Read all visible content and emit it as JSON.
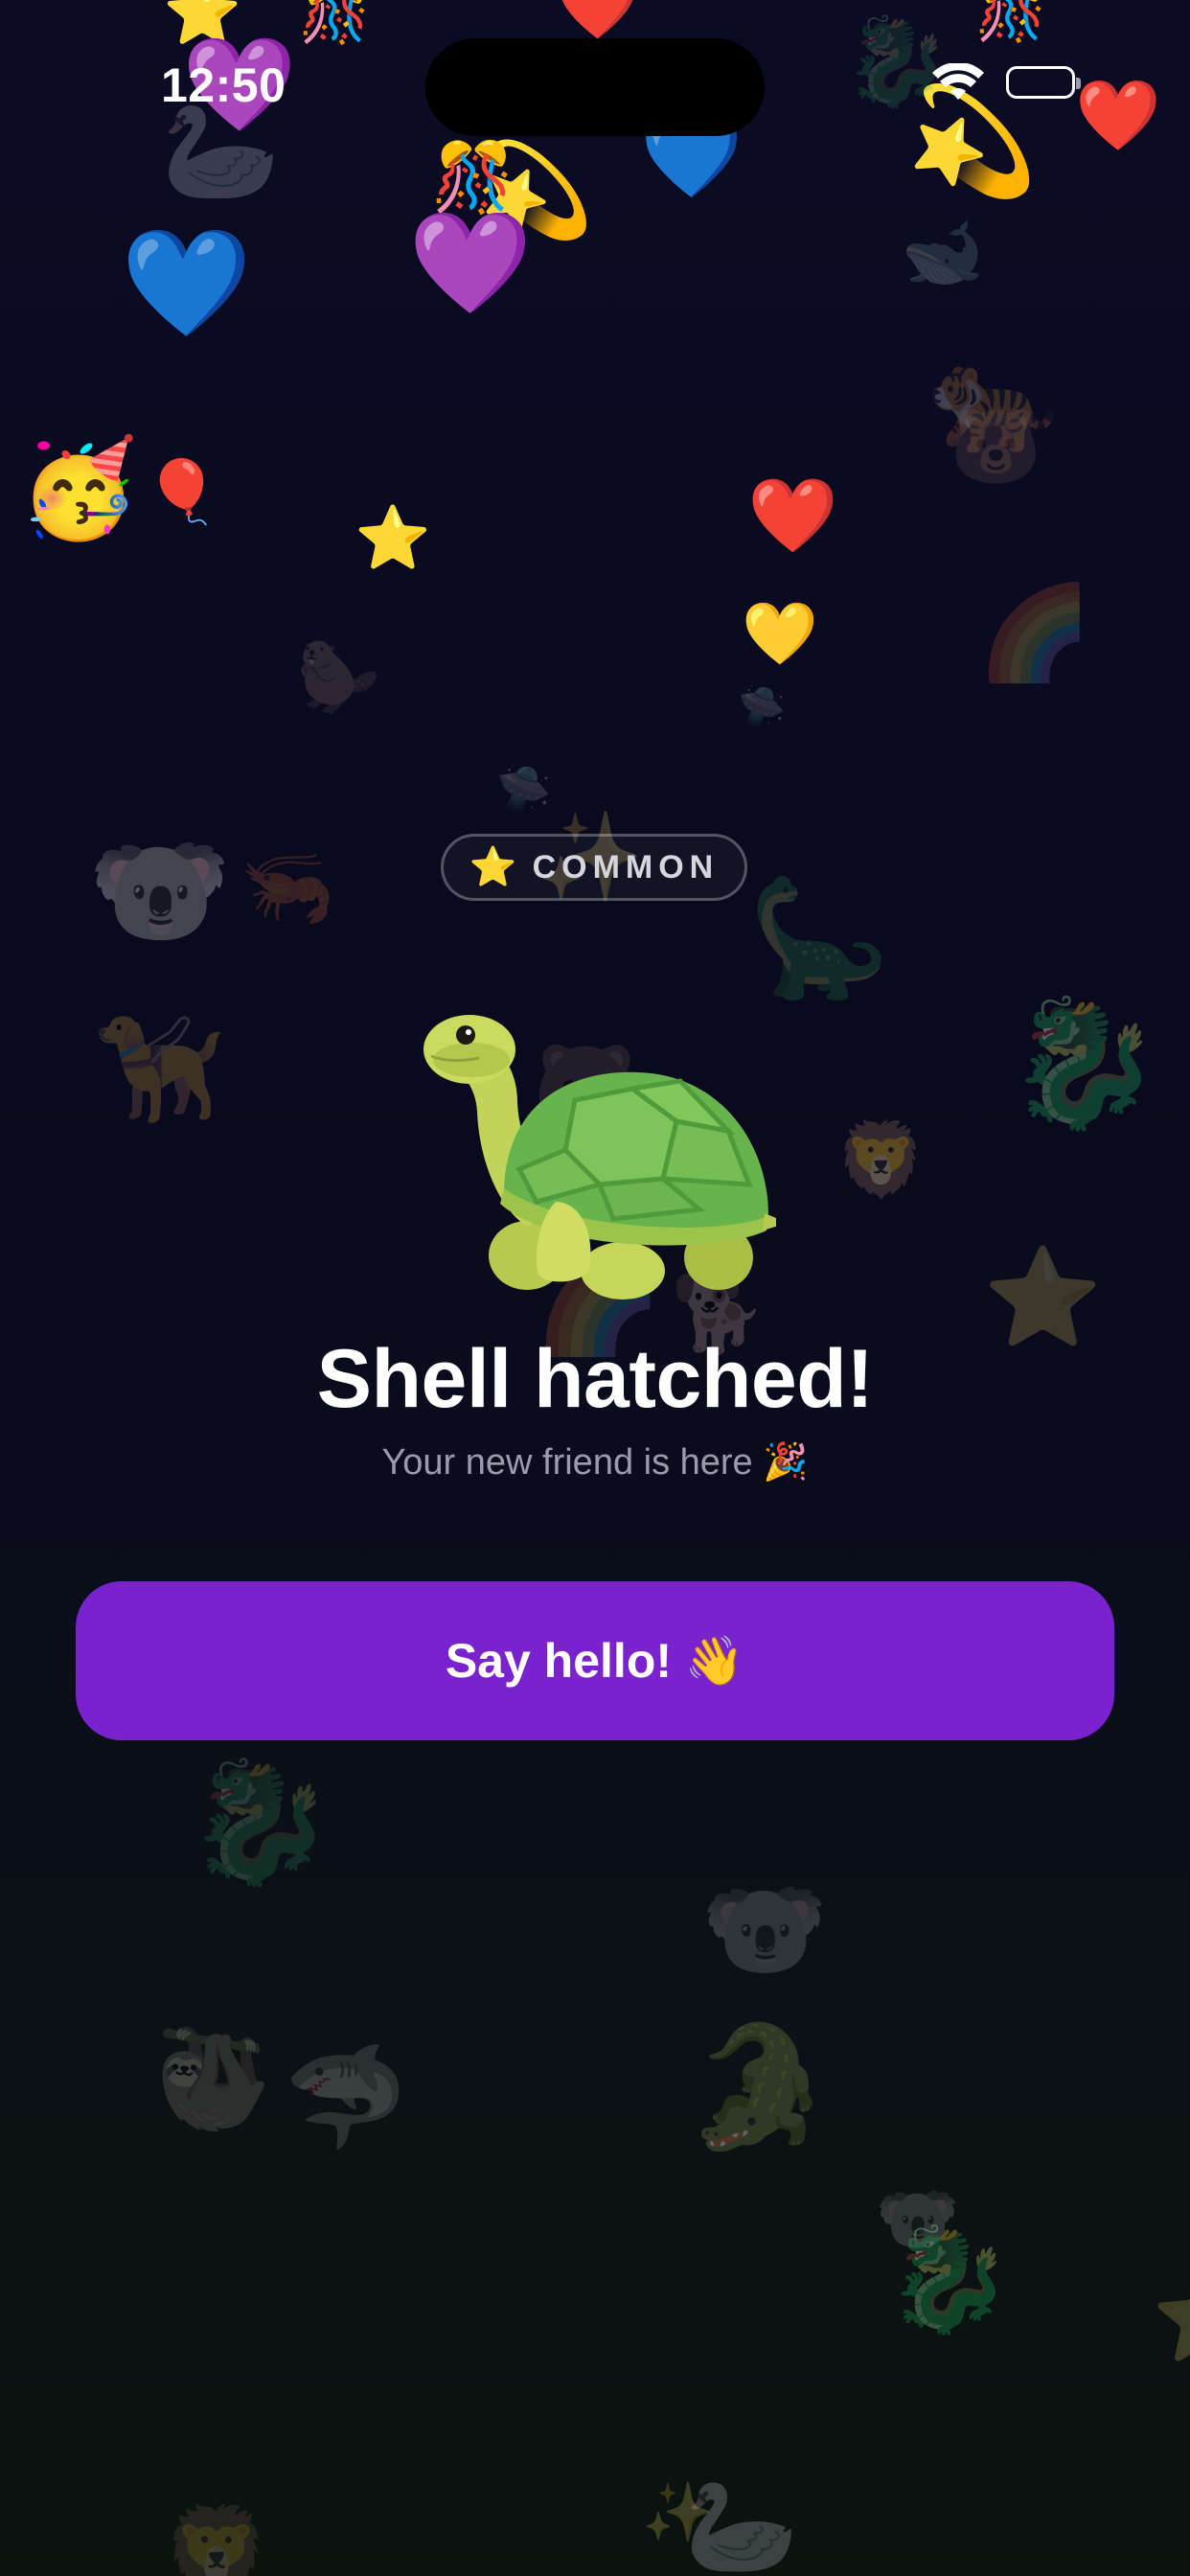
{
  "status_bar": {
    "time": "12:50"
  },
  "rarity": {
    "icon": "⭐",
    "label": "COMMON"
  },
  "pet": {
    "icon": "turtle-icon"
  },
  "title": "Shell hatched!",
  "subtitle": "Your new friend is here 🎉",
  "cta": {
    "label": "Say hello! 👋"
  },
  "colors": {
    "background_top": "#0b0b24",
    "background_bottom": "#0b130f",
    "accent": "#7b22cf",
    "subtitle": "#9b9bab"
  }
}
